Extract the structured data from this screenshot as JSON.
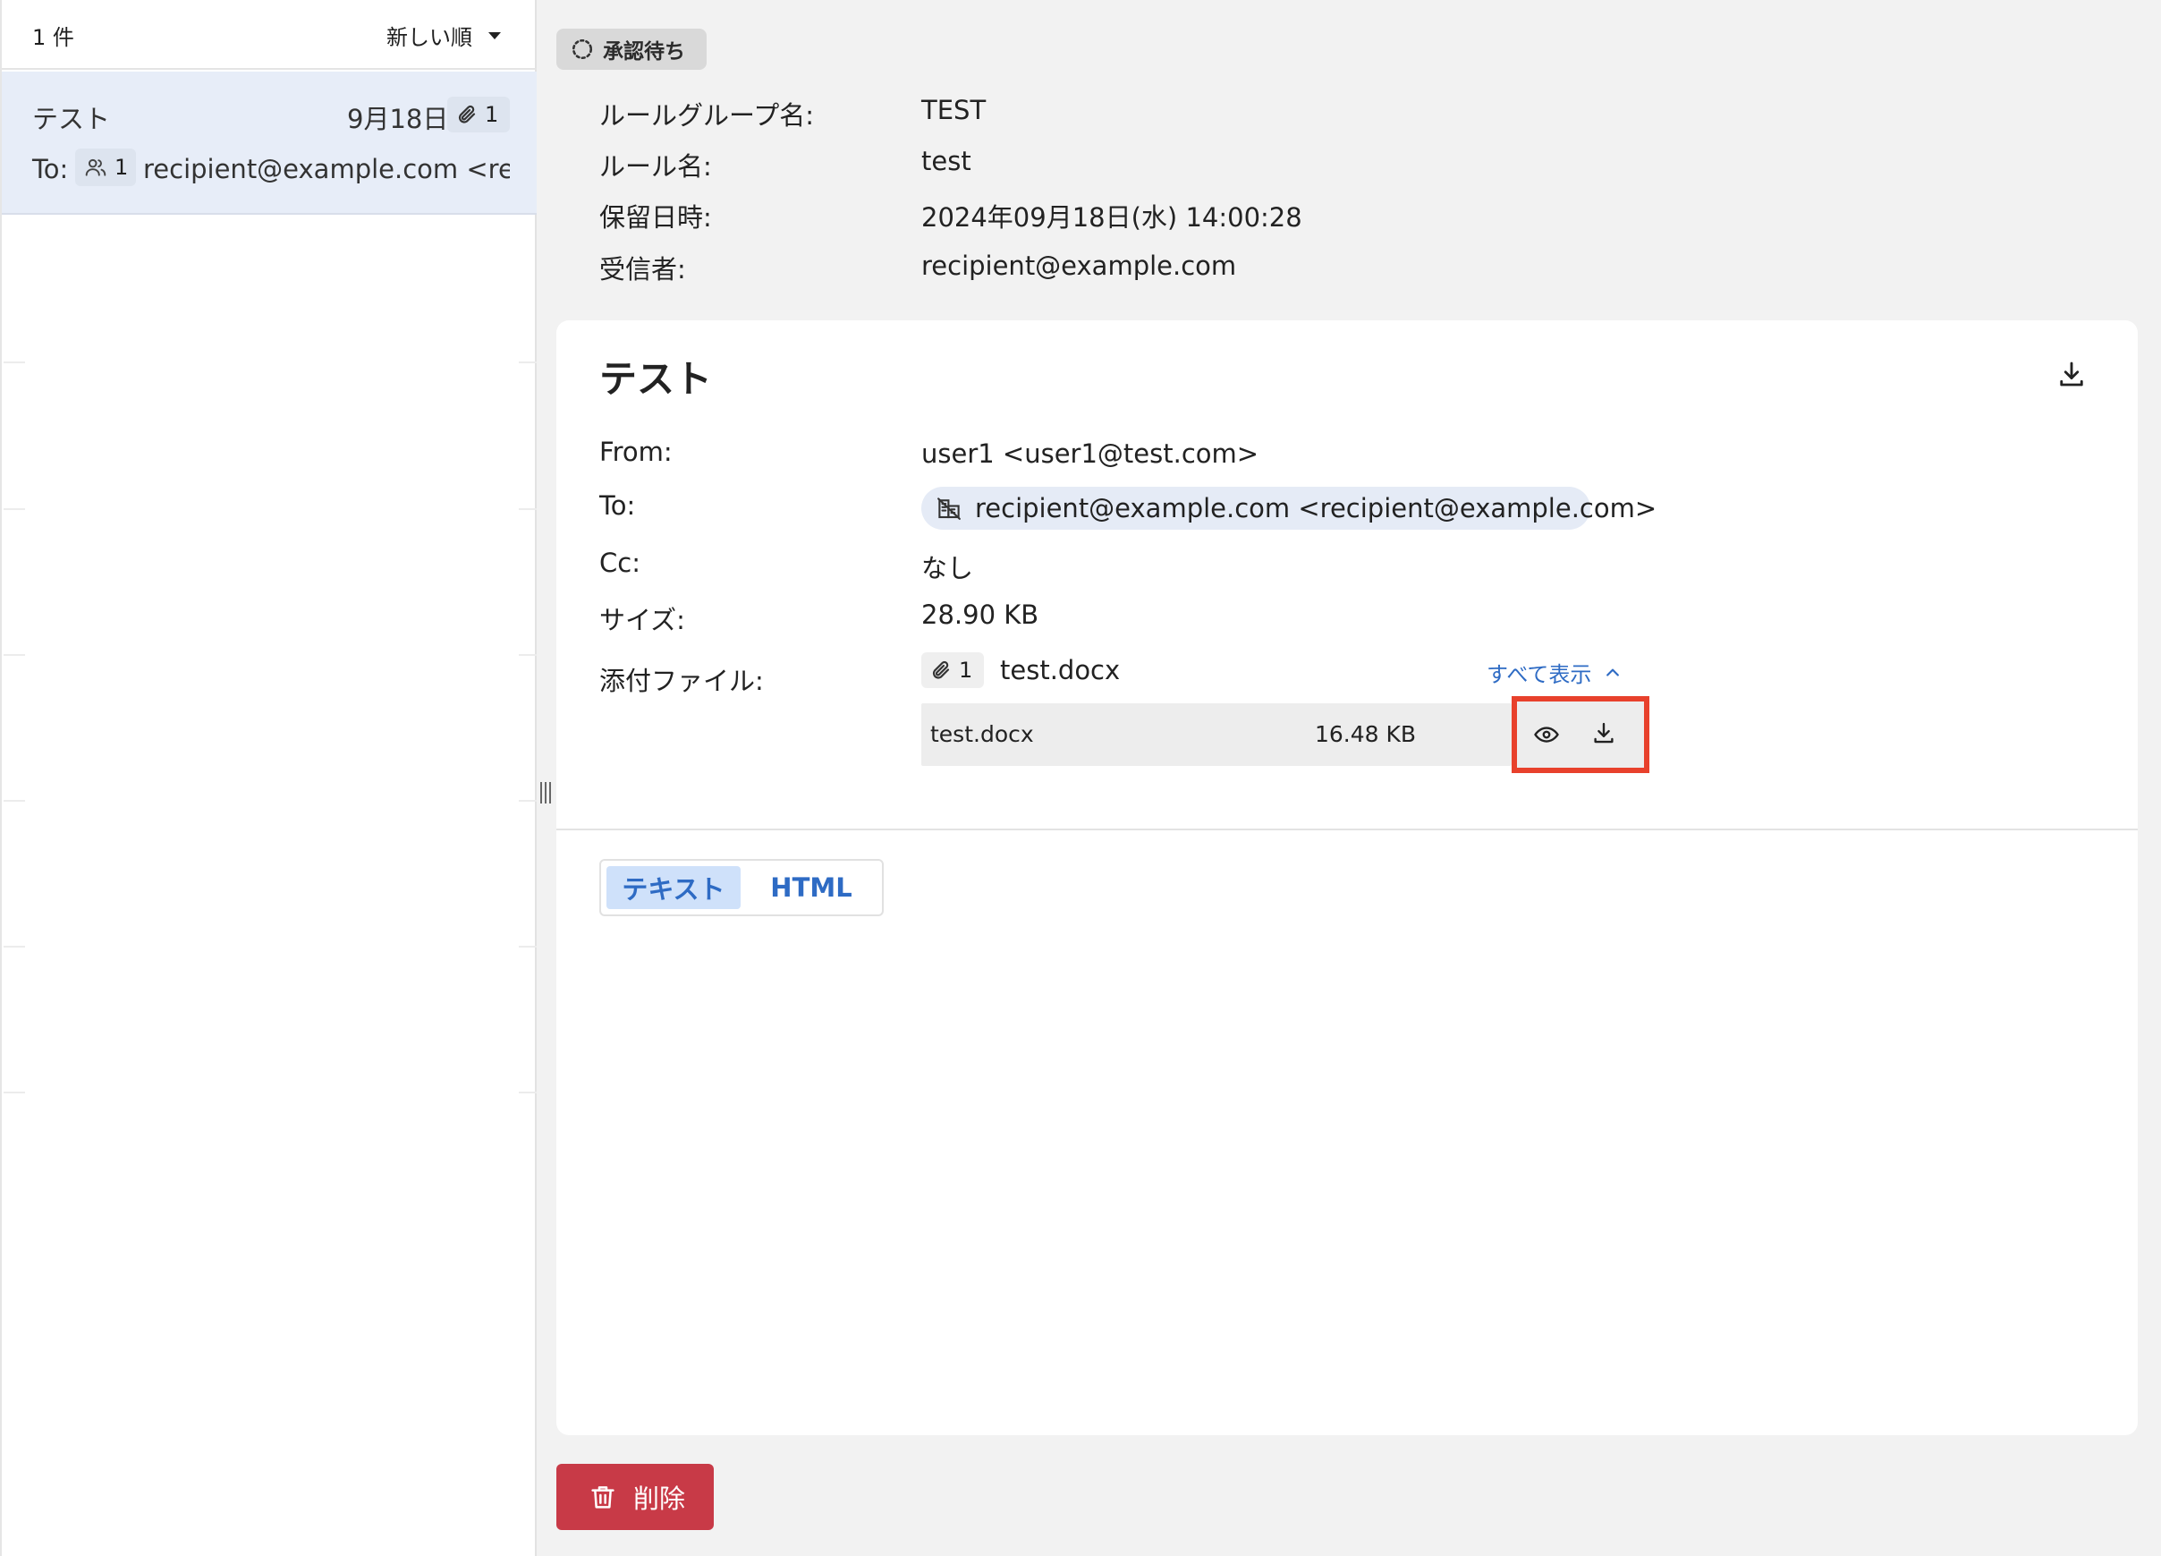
{
  "list": {
    "count_label": "1 件",
    "sort_label": "新しい順",
    "items": [
      {
        "subject": "テスト",
        "date": "9月18日",
        "attachment_count": "1",
        "to_label": "To:",
        "recipient_count": "1",
        "recipient": "recipient@example.com <rec..."
      }
    ]
  },
  "status": {
    "label": "承認待ち"
  },
  "meta": {
    "rule_group_label": "ルールグループ名:",
    "rule_group_value": "TEST",
    "rule_label": "ルール名:",
    "rule_value": "test",
    "held_at_label": "保留日時:",
    "held_at_value": "2024年09月18日(水) 14:00:28",
    "recipient_label": "受信者:",
    "recipient_value": "recipient@example.com"
  },
  "mail": {
    "subject": "テスト",
    "from_label": "From:",
    "from_value": "user1 <user1@test.com>",
    "to_label": "To:",
    "to_value": "recipient@example.com <recipient@example.com>",
    "cc_label": "Cc:",
    "cc_value": "なし",
    "size_label": "サイズ:",
    "size_value": "28.90 KB",
    "attachments_label": "添付ファイル:",
    "attachment_count": "1",
    "attachment_summary": "test.docx",
    "show_all_label": "すべて表示",
    "files": [
      {
        "name": "test.docx",
        "size": "16.48 KB"
      }
    ]
  },
  "body_tabs": {
    "text_label": "テキスト",
    "html_label": "HTML",
    "active": "text"
  },
  "actions": {
    "delete_label": "削除"
  },
  "colors": {
    "accent": "#2e6bc4",
    "selected_row": "#e7edf8",
    "delete": "#c83a47",
    "highlight": "#e8412c"
  }
}
